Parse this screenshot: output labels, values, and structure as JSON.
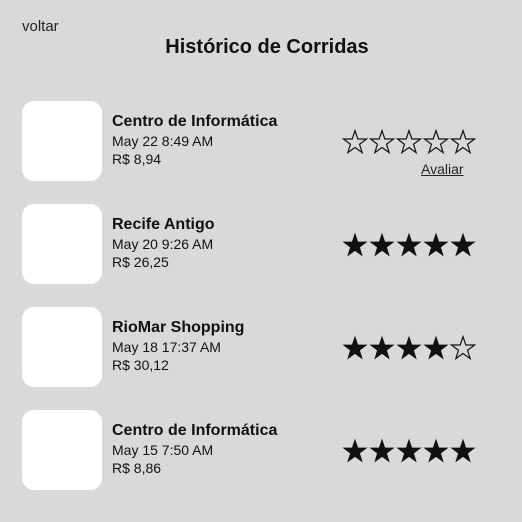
{
  "header": {
    "back_label": "voltar",
    "title": "Histórico de Corridas"
  },
  "colors": {
    "background": "#d9d9d9",
    "thumbnail": "#ffffff",
    "star_filled": "#111111",
    "star_outline": "#111111"
  },
  "rides": [
    {
      "destination": "Centro de Informática",
      "date": "May 22 8:49 AM",
      "price": "R$ 8,94",
      "rating": 0,
      "max_rating": 5,
      "rate_label": "Avaliar"
    },
    {
      "destination": "Recife Antigo",
      "date": "May 20 9:26 AM",
      "price": "R$ 26,25",
      "rating": 5,
      "max_rating": 5
    },
    {
      "destination": "RioMar Shopping",
      "date": "May 18 17:37 AM",
      "price": "R$ 30,12",
      "rating": 4,
      "max_rating": 5
    },
    {
      "destination": "Centro de Informática",
      "date": "May 15 7:50 AM",
      "price": "R$ 8,86",
      "rating": 5,
      "max_rating": 5
    }
  ]
}
